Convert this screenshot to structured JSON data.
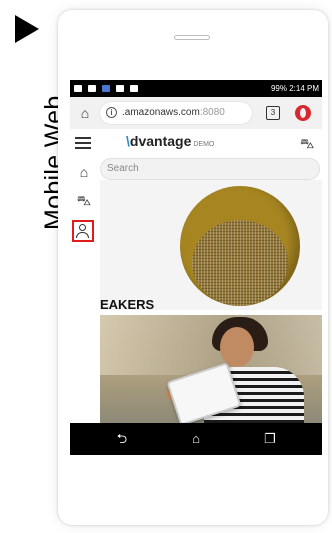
{
  "side_label": "Mobile Web",
  "status_bar": {
    "right_text": "99% 2:14 PM"
  },
  "browser": {
    "url_host": "amazonaws.com",
    "url_prefix": ".",
    "url_port": ":8080",
    "tab_count": "3"
  },
  "app": {
    "logo_mark": "\\",
    "logo_text": "dvantage",
    "logo_suffix": "DEMO",
    "search_placeholder": "Search",
    "section_label": "EAKERS"
  },
  "icons": {
    "home": "⌂",
    "cart": "🛒",
    "back": "⮌",
    "nav_home": "⌂",
    "recent": "❐"
  }
}
